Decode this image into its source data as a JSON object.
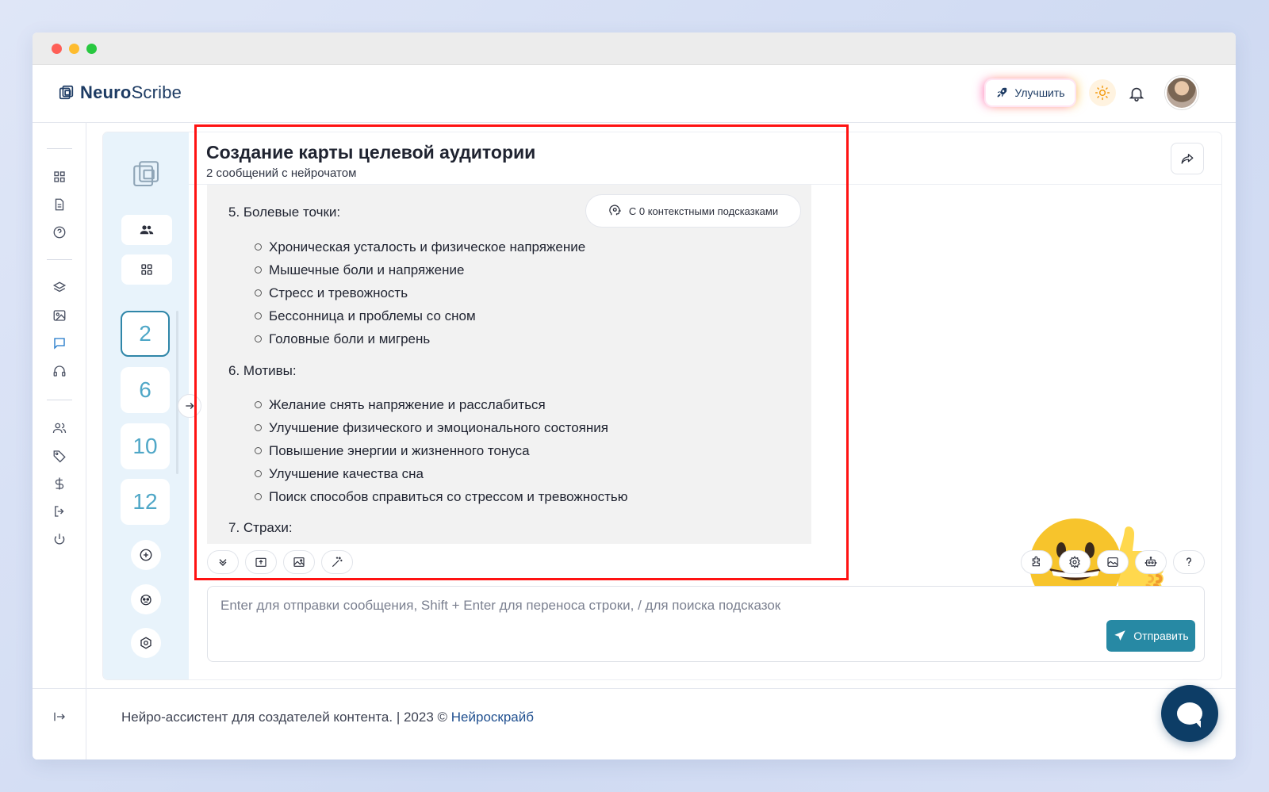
{
  "app": {
    "logo_bold": "Neuro",
    "logo_light": "Scribe",
    "logo_icon": "square-stack-logo"
  },
  "header": {
    "upgrade_label": "Улучшить",
    "theme_icon": "sun-icon",
    "notifications_icon": "bell-icon"
  },
  "chat": {
    "title": "Создание карты целевой аудитории",
    "subtitle": "2 сообщений с нейрочатом",
    "context_chip": "С 0 контекстными подсказками",
    "sections": [
      {
        "heading": "5. Болевые точки:",
        "items": [
          "Хроническая усталость и физическое напряжение",
          "Мышечные боли и напряжение",
          "Стресс и тревожность",
          "Бессонница и проблемы со сном",
          "Головные боли и мигрень"
        ]
      },
      {
        "heading": "6. Мотивы:",
        "items": [
          "Желание снять напряжение и расслабиться",
          "Улучшение физического и эмоционального состояния",
          "Повышение энергии и жизненного тонуса",
          "Улучшение качества сна",
          "Поиск способов справиться со стрессом и тревожностью"
        ]
      },
      {
        "heading": "7. Страхи:",
        "items": []
      }
    ]
  },
  "inner_sidebar": {
    "numbers": [
      "2",
      "6",
      "10",
      "12"
    ],
    "active_index": 0
  },
  "composer": {
    "placeholder": "Enter для отправки сообщения, Shift + Enter для переноса строки, / для поиска подсказок",
    "send_label": "Отправить"
  },
  "footer": {
    "text": "Нейро-ассистент для создателей контента.  | 2023 © ",
    "link": "Нейроскрайб"
  },
  "colors": {
    "accent": "#2789a4",
    "brand": "#1d3b63",
    "highlight": "#ff1212"
  }
}
